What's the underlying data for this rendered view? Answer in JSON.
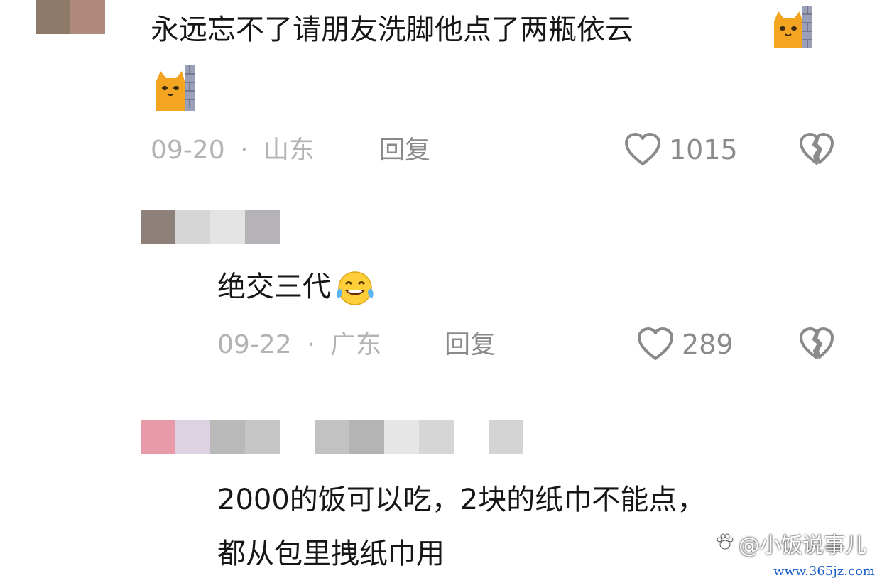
{
  "comments": [
    {
      "text": "永远忘不了请朋友洗脚他点了两瓶依云",
      "date": "09-20",
      "separator": "·",
      "location": "山东",
      "reply_label": "回复",
      "likes": "1015",
      "emoji_icon": "cat-peeking-wall-icon",
      "avatar_colors": [
        "#8f7a6a",
        "#b08a7a"
      ]
    },
    {
      "text": "绝交三代",
      "date": "09-22",
      "separator": "·",
      "location": "广东",
      "reply_label": "回复",
      "likes": "289",
      "emoji_icon": "laughing-tears-icon",
      "avatar_colors": [
        "#8d8179",
        "#d6d6d6",
        "#e3e3e3",
        "#b5b3b8"
      ]
    },
    {
      "text_line1": "2000的饭可以吃，2块的纸巾不能点，",
      "text_line2": "都从包里拽纸巾用",
      "avatar_colors": [
        "#e89aa8",
        "#dcd2e2",
        "#b9b9b9",
        "#c6c6c6",
        "#ffffff",
        "#c2c2c2",
        "#b4b4b4",
        "#e6e6e6",
        "#d6d6d6",
        "#ffffff",
        "#d4d4d4"
      ]
    }
  ],
  "icons": {
    "like": "heart-outline-icon",
    "dislike": "broken-heart-icon"
  },
  "watermark": {
    "text": "@小饭说事儿",
    "url": "www.365jz.com"
  },
  "colors": {
    "text": "#161616",
    "meta": "#b3b3b3",
    "action": "#8a8a8a"
  }
}
